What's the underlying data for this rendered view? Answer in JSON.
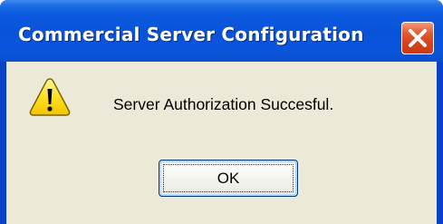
{
  "window": {
    "title": "Commercial Server Configuration",
    "close_icon": "close-icon"
  },
  "dialog": {
    "icon": "warning-icon",
    "message": "Server Authorization Succesful.",
    "ok_label": "OK"
  },
  "colors": {
    "titlebar": "#0853d8",
    "client_background": "#ece9d8",
    "close_button": "#d2411c",
    "warning_yellow": "#ffd800"
  }
}
